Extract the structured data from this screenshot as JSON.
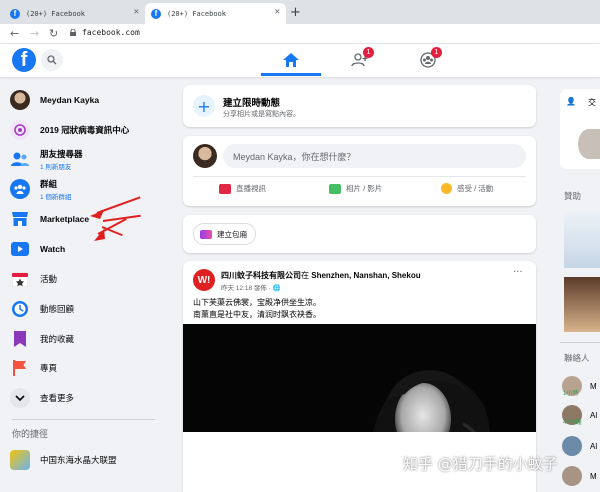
{
  "browser": {
    "tabs": [
      {
        "title": "(20+) Facebook",
        "active": false
      },
      {
        "title": "(20+) Facebook",
        "active": true
      }
    ],
    "new_tab_symbol": "+",
    "url": "facebook.com"
  },
  "header": {
    "logo": "f",
    "badges": {
      "friends": "1",
      "groups": "1"
    }
  },
  "sidebar": {
    "items": [
      {
        "label": "Meydan Kayka",
        "sub": "",
        "icon": "profile-avatar"
      },
      {
        "label": "2019 冠狀病毒資訊中心",
        "sub": "",
        "icon": "covid-info-icon"
      },
      {
        "label": "朋友搜尋器",
        "sub": "1 則新朋友",
        "icon": "friends-icon"
      },
      {
        "label": "群組",
        "sub": "1 個新群組",
        "icon": "groups-icon"
      },
      {
        "label": "Marketplace",
        "sub": "",
        "icon": "marketplace-icon"
      },
      {
        "label": "Watch",
        "sub": "",
        "icon": "watch-icon"
      },
      {
        "label": "活動",
        "sub": "",
        "icon": "events-icon"
      },
      {
        "label": "動態回顧",
        "sub": "",
        "icon": "memories-icon"
      },
      {
        "label": "我的收藏",
        "sub": "",
        "icon": "saved-icon"
      },
      {
        "label": "專頁",
        "sub": "",
        "icon": "pages-icon"
      },
      {
        "label": "查看更多",
        "sub": "",
        "icon": "chevron-down-icon"
      }
    ],
    "shortcuts_title": "你的捷徑",
    "shortcuts": [
      {
        "label": "中国东海水晶大联盟"
      }
    ]
  },
  "feed": {
    "story": {
      "title": "建立限時動態",
      "subtitle": "分享相片或是寫點內容。"
    },
    "composer": {
      "placeholder": "Meydan Kayka，你在想什麼？",
      "actions": {
        "live": "直播視訊",
        "photo": "相片 / 影片",
        "feeling": "感受 / 活動"
      }
    },
    "room": {
      "label": "建立包廂"
    },
    "post": {
      "logo": "W!",
      "author": "四川蚊子科技有限公司",
      "at": "在",
      "location": "Shenzhen, Nanshan, Shekou",
      "time": "昨天 12:18 發佈 · ",
      "more": "···",
      "lines": [
        "山下芙蕖云佛裳，宝殿净供坐生凉。",
        "南薰直是社中友，清润时飘衣袂香。"
      ]
    }
  },
  "right": {
    "create_label": "交",
    "sponsored": "贊助",
    "contacts_title": "聯絡人",
    "contacts": [
      {
        "name": "M",
        "badge": "1小時"
      },
      {
        "name": "Al",
        "badge": "47分鐘"
      },
      {
        "name": "Al",
        "badge": ""
      },
      {
        "name": "M",
        "badge": ""
      }
    ]
  },
  "watermark": "知乎 @猎刀手的小蚊子",
  "colors": {
    "brand": "#1877f2",
    "annotation_arrow": "#e02020",
    "badge": "#e41e3f"
  }
}
